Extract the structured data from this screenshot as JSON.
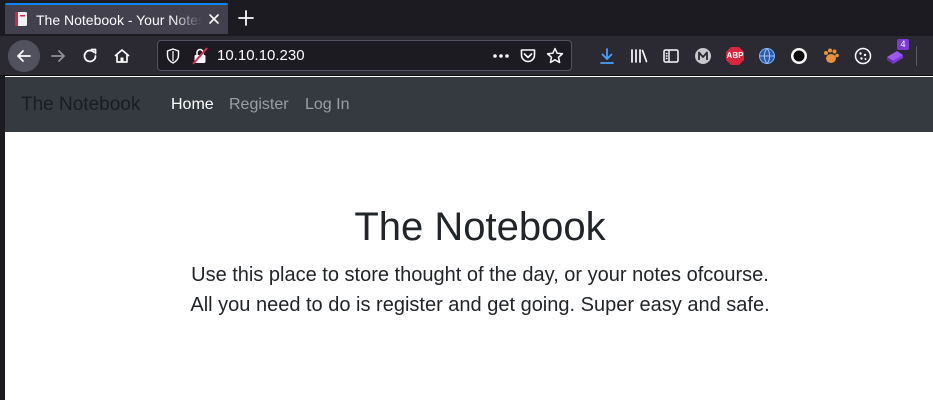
{
  "browser": {
    "tab": {
      "title": "The Notebook - Your Notes"
    },
    "url": "10.10.10.230",
    "extensions_badge": "4",
    "adblock_label": "ABP"
  },
  "site": {
    "brand": "The Notebook",
    "nav": [
      {
        "label": "Home",
        "active": true
      },
      {
        "label": "Register",
        "active": false
      },
      {
        "label": "Log In",
        "active": false
      }
    ]
  },
  "hero": {
    "title": "The Notebook",
    "line1": "Use this place to store thought of the day, or your notes ofcourse.",
    "line2": "All you need to do is register and get going. Super easy and safe."
  },
  "colors": {
    "tab_accent": "#0a84ff",
    "site_nav_bg": "#343a40",
    "text": "#212529"
  }
}
